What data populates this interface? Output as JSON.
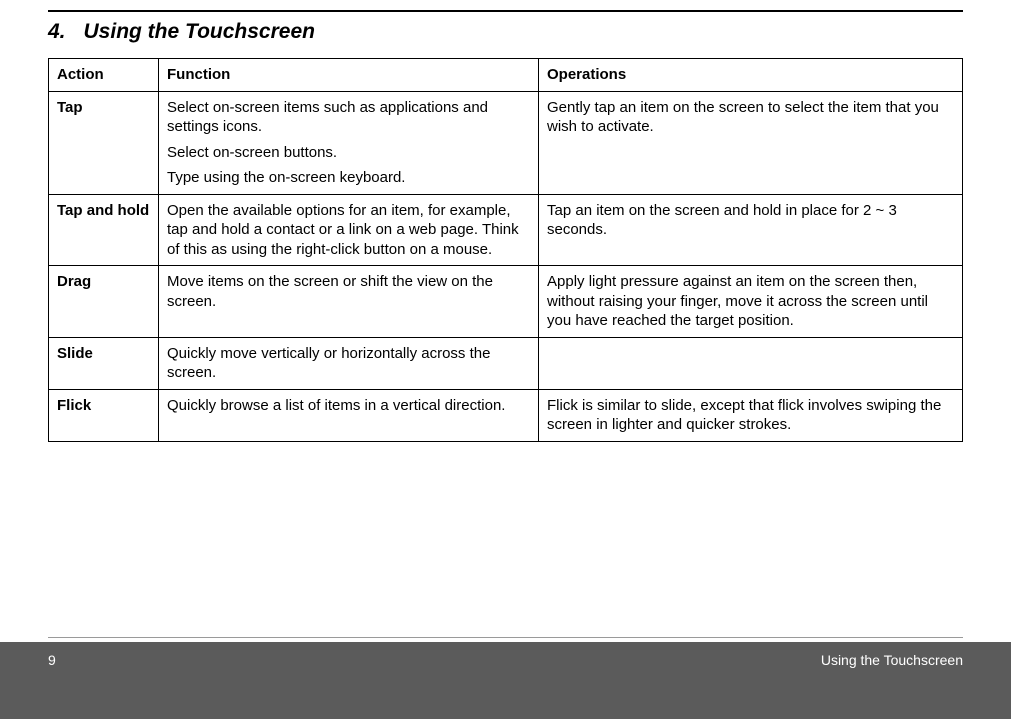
{
  "section": {
    "number": "4.",
    "title": "Using the Touchscreen"
  },
  "table": {
    "headers": {
      "action": "Action",
      "function": "Function",
      "operations": "Operations"
    },
    "rows": [
      {
        "action": "Tap",
        "function": [
          "Select on-screen items such as applications and settings icons.",
          "Select on-screen buttons.",
          "Type using the on-screen keyboard."
        ],
        "operations": "Gently tap an item on the screen to select the item that you wish to activate."
      },
      {
        "action": "Tap and hold",
        "function": [
          "Open the available options for an item, for example, tap and hold a contact or a link on a web page. Think of this as using the right-click button on a mouse."
        ],
        "operations": "Tap an item on the screen and hold in place for 2 ~ 3 seconds."
      },
      {
        "action": "Drag",
        "function": [
          "Move items on the screen or shift the view on the screen."
        ],
        "operations": "Apply light pressure against an item on the screen then, without raising your finger, move it across the screen until you have reached the target position."
      },
      {
        "action": "Slide",
        "function": [
          "Quickly move vertically or horizontally across the screen."
        ],
        "operations": ""
      },
      {
        "action": "Flick",
        "function": [
          "Quickly browse a list of items in a vertical direction."
        ],
        "operations": "Flick is similar to slide, except that flick involves swiping the screen in lighter and quicker strokes."
      }
    ]
  },
  "footer": {
    "page": "9",
    "label": "Using the Touchscreen"
  }
}
